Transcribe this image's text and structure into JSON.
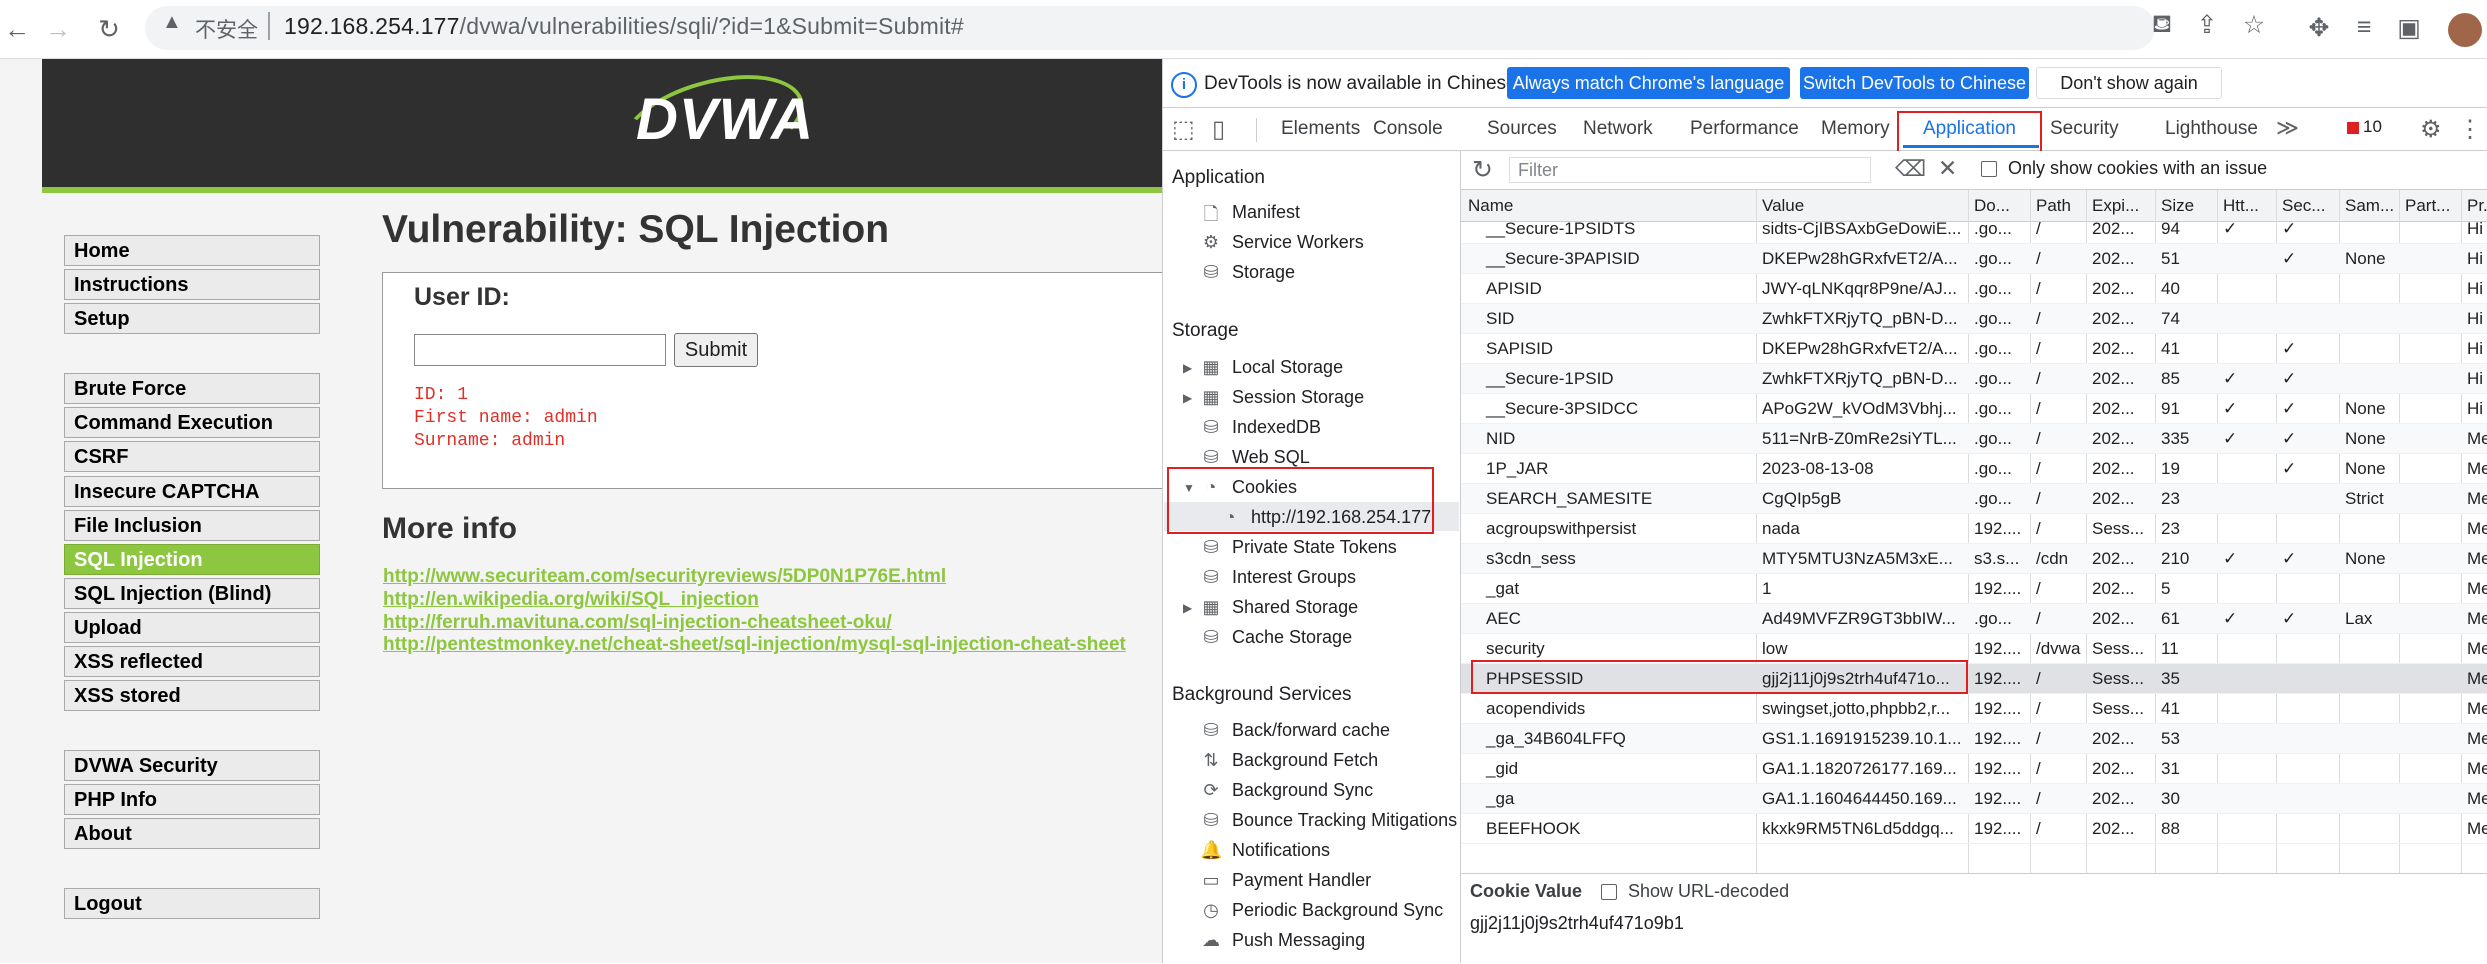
{
  "browser": {
    "insecure_label": "不安全",
    "url_host": "192.168.254.177",
    "url_path": "/dvwa/vulnerabilities/sqli/?id=1&Submit=Submit#"
  },
  "dvwa": {
    "logo": "DVWA",
    "menu": [
      {
        "label": "Home",
        "active": false
      },
      {
        "label": "Instructions",
        "active": false
      },
      {
        "label": "Setup",
        "active": false
      },
      {
        "label": "Brute Force",
        "active": false
      },
      {
        "label": "Command Execution",
        "active": false
      },
      {
        "label": "CSRF",
        "active": false
      },
      {
        "label": "Insecure CAPTCHA",
        "active": false
      },
      {
        "label": "File Inclusion",
        "active": false
      },
      {
        "label": "SQL Injection",
        "active": true
      },
      {
        "label": "SQL Injection (Blind)",
        "active": false
      },
      {
        "label": "Upload",
        "active": false
      },
      {
        "label": "XSS reflected",
        "active": false
      },
      {
        "label": "XSS stored",
        "active": false
      },
      {
        "label": "DVWA Security",
        "active": false
      },
      {
        "label": "PHP Info",
        "active": false
      },
      {
        "label": "About",
        "active": false
      },
      {
        "label": "Logout",
        "active": false
      }
    ],
    "title": "Vulnerability: SQL Injection",
    "user_id_label": "User ID:",
    "user_id_value": "",
    "submit_label": "Submit",
    "result_lines": [
      "ID: 1",
      "First name: admin",
      "Surname: admin"
    ],
    "more_info_title": "More info",
    "links": [
      "http://www.securiteam.com/securityreviews/5DP0N1P76E.html",
      "http://en.wikipedia.org/wiki/SQL_injection",
      "http://ferruh.mavituna.com/sql-injection-cheatsheet-oku/",
      "http://pentestmonkey.net/cheat-sheet/sql-injection/mysql-sql-injection-cheat-sheet"
    ],
    "colors": {
      "accent": "#8dc63f",
      "header": "#2f2f2f",
      "result": "#e0302a"
    }
  },
  "devtools": {
    "infobar_text": "DevTools is now available in Chinese!",
    "btn_match": "Always match Chrome's language",
    "btn_switch": "Switch DevTools to Chinese",
    "btn_dontshow": "Don't show again",
    "tabs": [
      "Elements",
      "Console",
      "Sources",
      "Network",
      "Performance",
      "Memory",
      "Application",
      "Security",
      "Lighthouse"
    ],
    "active_tab": "Application",
    "error_count": "10",
    "sidebar": {
      "app_header": "Application",
      "app_items": [
        "Manifest",
        "Service Workers",
        "Storage"
      ],
      "storage_header": "Storage",
      "storage_items": [
        "Local Storage",
        "Session Storage",
        "IndexedDB",
        "Web SQL",
        "Cookies",
        "http://192.168.254.177",
        "Private State Tokens",
        "Interest Groups",
        "Shared Storage",
        "Cache Storage"
      ],
      "bg_header": "Background Services",
      "bg_items": [
        "Back/forward cache",
        "Background Fetch",
        "Background Sync",
        "Bounce Tracking Mitigations",
        "Notifications",
        "Payment Handler",
        "Periodic Background Sync",
        "Push Messaging"
      ]
    },
    "cookies": {
      "filter_placeholder": "Filter",
      "only_issue_label": "Only show cookies with an issue",
      "columns": [
        "Name",
        "Value",
        "Do...",
        "Path",
        "Expi...",
        "Size",
        "Htt...",
        "Sec...",
        "Sam...",
        "Part...",
        "Pr..."
      ],
      "rows": [
        [
          "__Secure-1PSIDTS",
          "sidts-CjIBSAxbGeDowiE...",
          ".go...",
          "/",
          "202...",
          "94",
          "✓",
          "✓",
          "",
          "",
          "Hi"
        ],
        [
          "__Secure-3PAPISID",
          "DKEPw28hGRxfvET2/A...",
          ".go...",
          "/",
          "202...",
          "51",
          "",
          "✓",
          "None",
          "",
          "Hi"
        ],
        [
          "APISID",
          "JWY-qLNKqqr8P9ne/AJ...",
          ".go...",
          "/",
          "202...",
          "40",
          "",
          "",
          "",
          "",
          "Hi"
        ],
        [
          "SID",
          "ZwhkFTXRjyTQ_pBN-D...",
          ".go...",
          "/",
          "202...",
          "74",
          "",
          "",
          "",
          "",
          "Hi"
        ],
        [
          "SAPISID",
          "DKEPw28hGRxfvET2/A...",
          ".go...",
          "/",
          "202...",
          "41",
          "",
          "✓",
          "",
          "",
          "Hi"
        ],
        [
          "__Secure-1PSID",
          "ZwhkFTXRjyTQ_pBN-D...",
          ".go...",
          "/",
          "202...",
          "85",
          "✓",
          "✓",
          "",
          "",
          "Hi"
        ],
        [
          "__Secure-3PSIDCC",
          "APoG2W_kVOdM3Vbhj...",
          ".go...",
          "/",
          "202...",
          "91",
          "✓",
          "✓",
          "None",
          "",
          "Hi"
        ],
        [
          "NID",
          "511=NrB-Z0mRe2siYTL...",
          ".go...",
          "/",
          "202...",
          "335",
          "✓",
          "✓",
          "None",
          "",
          "Me"
        ],
        [
          "1P_JAR",
          "2023-08-13-08",
          ".go...",
          "/",
          "202...",
          "19",
          "",
          "✓",
          "None",
          "",
          "Me"
        ],
        [
          "SEARCH_SAMESITE",
          "CgQIp5gB",
          ".go...",
          "/",
          "202...",
          "23",
          "",
          "",
          "Strict",
          "",
          "Me"
        ],
        [
          "acgroupswithpersist",
          "nada",
          "192....",
          "/",
          "Sess...",
          "23",
          "",
          "",
          "",
          "",
          "Me"
        ],
        [
          "s3cdn_sess",
          "MTY5MTU3NzA5M3xE...",
          "s3.s...",
          "/cdn",
          "202...",
          "210",
          "✓",
          "✓",
          "None",
          "",
          "Me"
        ],
        [
          "_gat",
          "1",
          "192....",
          "/",
          "202...",
          "5",
          "",
          "",
          "",
          "",
          "Me"
        ],
        [
          "AEC",
          "Ad49MVFZR9GT3bbIW...",
          ".go...",
          "/",
          "202...",
          "61",
          "✓",
          "✓",
          "Lax",
          "",
          "Me"
        ],
        [
          "security",
          "low",
          "192....",
          "/dvwa",
          "Sess...",
          "11",
          "",
          "",
          "",
          "",
          "Me"
        ],
        [
          "PHPSESSID",
          "gjj2j11j0j9s2trh4uf471o...",
          "192....",
          "/",
          "Sess...",
          "35",
          "",
          "",
          "",
          "",
          "Me"
        ],
        [
          "acopendivids",
          "swingset,jotto,phpbb2,r...",
          "192....",
          "/",
          "Sess...",
          "41",
          "",
          "",
          "",
          "",
          "Me"
        ],
        [
          "_ga_34B604LFFQ",
          "GS1.1.1691915239.10.1...",
          "192....",
          "/",
          "202...",
          "53",
          "",
          "",
          "",
          "",
          "Me"
        ],
        [
          "_gid",
          "GA1.1.1820726177.169...",
          "192....",
          "/",
          "202...",
          "31",
          "",
          "",
          "",
          "",
          "Me"
        ],
        [
          "_ga",
          "GA1.1.1604644450.169...",
          "192....",
          "/",
          "202...",
          "30",
          "",
          "",
          "",
          "",
          "Me"
        ],
        [
          "BEEFHOOK",
          "kkxk9RM5TN6Ld5ddgq...",
          "192....",
          "/",
          "202...",
          "88",
          "",
          "",
          "",
          "",
          "Me"
        ]
      ],
      "selected_row": 15,
      "cookie_value_title": "Cookie Value",
      "show_url_decoded": "Show URL-decoded",
      "cookie_value": "gjj2j11j0j9s2trh4uf471o9b1"
    }
  }
}
